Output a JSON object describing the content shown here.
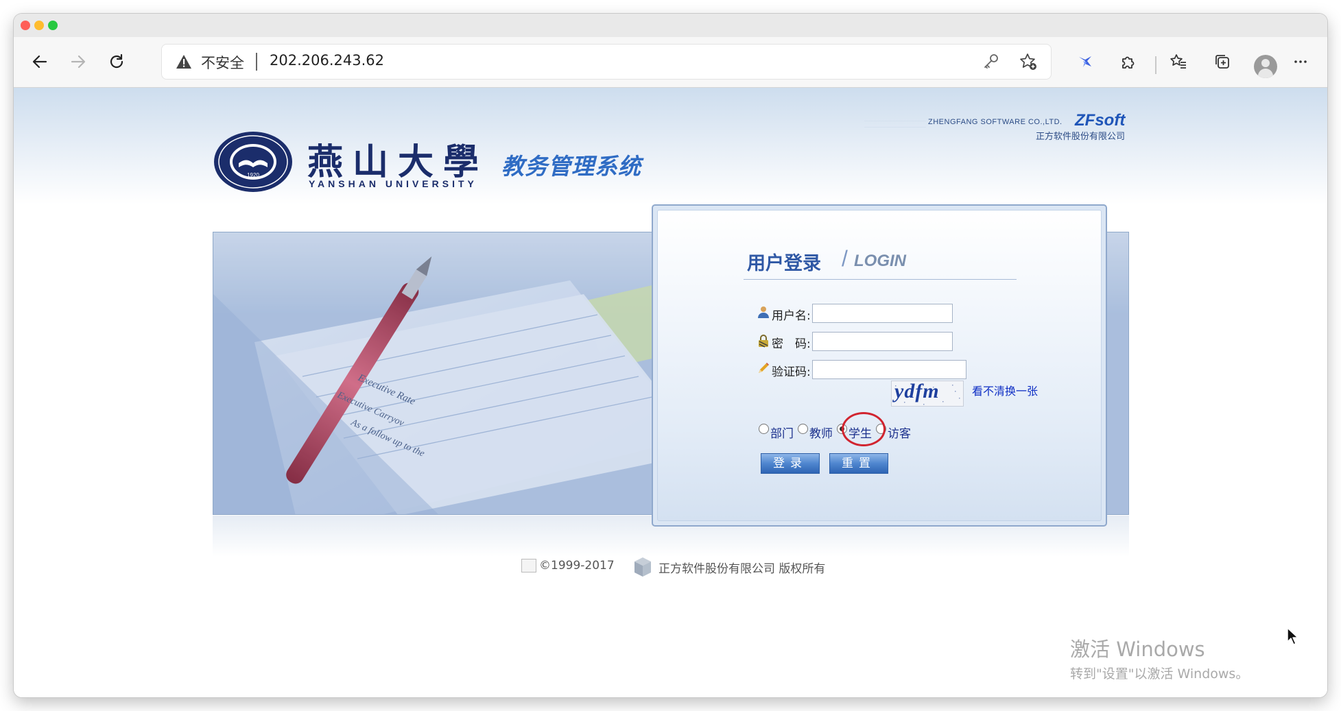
{
  "browser": {
    "address_security_label": "不安全",
    "address_url": "202.206.243.62",
    "icons": [
      "back-icon",
      "forward-icon",
      "reload-icon",
      "warning-icon",
      "key-icon",
      "add-favorite-icon",
      "extension-bird-icon",
      "extensions-puzzle-icon",
      "favorites-icon",
      "collections-icon",
      "profile-avatar-icon",
      "more-icon"
    ]
  },
  "header": {
    "vendor_en": "ZHENGFANG SOFTWARE CO.,LTD.",
    "vendor_logo": "ZFsoft",
    "vendor_cn": "正方软件股份有限公司",
    "seal_year": "1920",
    "school_cn": "燕山大學",
    "school_en": "YANSHAN UNIVERSITY",
    "system_title": "教务管理系统"
  },
  "banner": {
    "paper_text_1": "Executive Rate",
    "paper_text_2": "Executive Carryov",
    "paper_text_3": "As a follow up to the"
  },
  "login": {
    "title_cn": "用户登录",
    "title_en": "LOGIN",
    "username_label": "用户名:",
    "password_label": "密　码:",
    "captcha_label": "验证码:",
    "username_value": "",
    "password_value": "",
    "captcha_value": "",
    "captcha_image_text": "ydfm",
    "refresh_captcha": "看不清换一张",
    "roles": [
      {
        "label": "部门",
        "checked": false
      },
      {
        "label": "教师",
        "checked": false
      },
      {
        "label": "学生",
        "checked": true
      },
      {
        "label": "访客",
        "checked": false
      }
    ],
    "login_button": "登录",
    "reset_button": "重置",
    "highlight_color": "#d1242f"
  },
  "footer": {
    "copyright": "©1999-2017",
    "company": "正方软件股份有限公司 版权所有"
  },
  "watermark": {
    "title": "激活 Windows",
    "subtitle": "转到\"设置\"以激活 Windows。"
  }
}
